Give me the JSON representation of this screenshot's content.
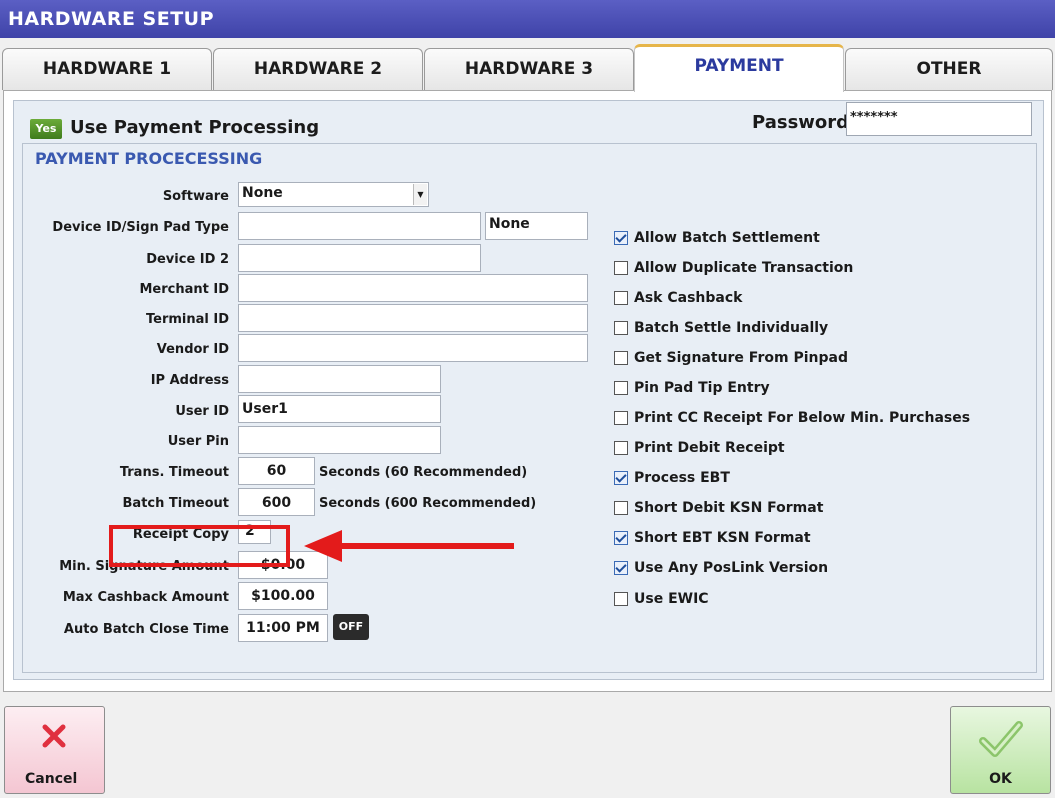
{
  "window": {
    "title": "HARDWARE SETUP"
  },
  "tabs": [
    {
      "label": "HARDWARE 1"
    },
    {
      "label": "HARDWARE 2"
    },
    {
      "label": "HARDWARE 3"
    },
    {
      "label": "PAYMENT"
    },
    {
      "label": "OTHER"
    }
  ],
  "active_tab": "PAYMENT",
  "header": {
    "yes_badge": "Yes",
    "use_payment_label": "Use Payment Processing",
    "password_label": "Password",
    "password_value": "*******"
  },
  "section_title": "PAYMENT PROCECESSING",
  "fields": {
    "software_label": "Software",
    "software_value": "None",
    "device_type_label": "Device ID/Sign Pad Type",
    "device_type_value": "",
    "device_type_extra": "None",
    "device_id2_label": "Device ID 2",
    "device_id2_value": "",
    "merchant_id_label": "Merchant ID",
    "merchant_id_value": "",
    "terminal_id_label": "Terminal ID",
    "terminal_id_value": "",
    "vendor_id_label": "Vendor ID",
    "vendor_id_value": "",
    "ip_label": "IP Address",
    "ip_value": "",
    "user_id_label": "User ID",
    "user_id_value": "User1",
    "user_pin_label": "User Pin",
    "user_pin_value": "",
    "trans_timeout_label": "Trans. Timeout",
    "trans_timeout_value": "60",
    "trans_timeout_suffix": "Seconds (60 Recommended)",
    "batch_timeout_label": "Batch Timeout",
    "batch_timeout_value": "600",
    "batch_timeout_suffix": "Seconds (600 Recommended)",
    "receipt_copy_label": "Receipt Copy",
    "receipt_copy_value": "2",
    "min_sig_label": "Min. Signature Amount",
    "min_sig_value": "$0.00",
    "max_cashback_label": "Max Cashback Amount",
    "max_cashback_value": "$100.00",
    "auto_batch_label": "Auto Batch Close Time",
    "auto_batch_value": "11:00 PM",
    "auto_batch_toggle": "OFF"
  },
  "checkboxes": [
    {
      "label": "Allow Batch Settlement",
      "checked": true
    },
    {
      "label": "Allow Duplicate Transaction",
      "checked": false
    },
    {
      "label": "Ask Cashback",
      "checked": false
    },
    {
      "label": "Batch Settle Individually",
      "checked": false
    },
    {
      "label": "Get Signature From Pinpad",
      "checked": false
    },
    {
      "label": "Pin Pad Tip Entry",
      "checked": false
    },
    {
      "label": "Print CC Receipt For Below Min. Purchases",
      "checked": false
    },
    {
      "label": "Print Debit Receipt",
      "checked": false
    },
    {
      "label": "Process EBT",
      "checked": true
    },
    {
      "label": "Short Debit KSN Format",
      "checked": false
    },
    {
      "label": "Short EBT KSN Format",
      "checked": true
    },
    {
      "label": "Use Any PosLink Version",
      "checked": true
    },
    {
      "label": "Use EWIC",
      "checked": false
    }
  ],
  "buttons": {
    "cancel": "Cancel",
    "ok": "OK"
  },
  "colors": {
    "title_bar": "#4a4eb5",
    "active_tab_text": "#2b3a9e",
    "highlight": "#e31b1b",
    "ok_green": "#b8e3a1",
    "cancel_pink": "#f4c6d2"
  }
}
